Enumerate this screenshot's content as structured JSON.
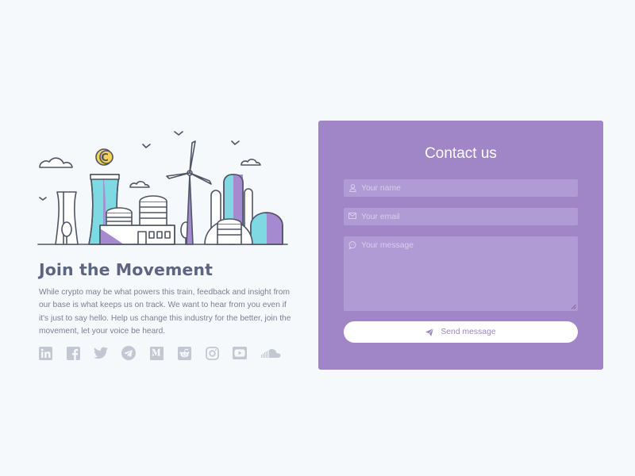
{
  "section": {
    "headline": "Join the Movement",
    "blurb": "While crypto may be what powers this train, feedback and insight from our base is what keeps us on track. We want to hear from you even if it's just to say hello. Help us change this industry for the better, join the movement, let your voice be heard."
  },
  "illustration": {
    "coin_letter": "C"
  },
  "social": [
    {
      "icon": "linkedin-icon"
    },
    {
      "icon": "facebook-icon"
    },
    {
      "icon": "twitter-icon"
    },
    {
      "icon": "telegram-icon"
    },
    {
      "icon": "medium-icon"
    },
    {
      "icon": "reddit-icon"
    },
    {
      "icon": "instagram-icon"
    },
    {
      "icon": "youtube-icon"
    },
    {
      "icon": "soundcloud-icon"
    }
  ],
  "contact": {
    "title": "Contact us",
    "name_placeholder": "Your name",
    "email_placeholder": "Your email",
    "message_placeholder": "Your message",
    "send_label": "Send message"
  },
  "colors": {
    "background": "#f6f9fc",
    "card": "#a086c6",
    "field": "#b09bd5",
    "icon_gray": "#c3c7d1",
    "accent_cyan": "#7fd9e3",
    "accent_purple": "#a58ad0",
    "coin_yellow": "#f5d15a"
  }
}
